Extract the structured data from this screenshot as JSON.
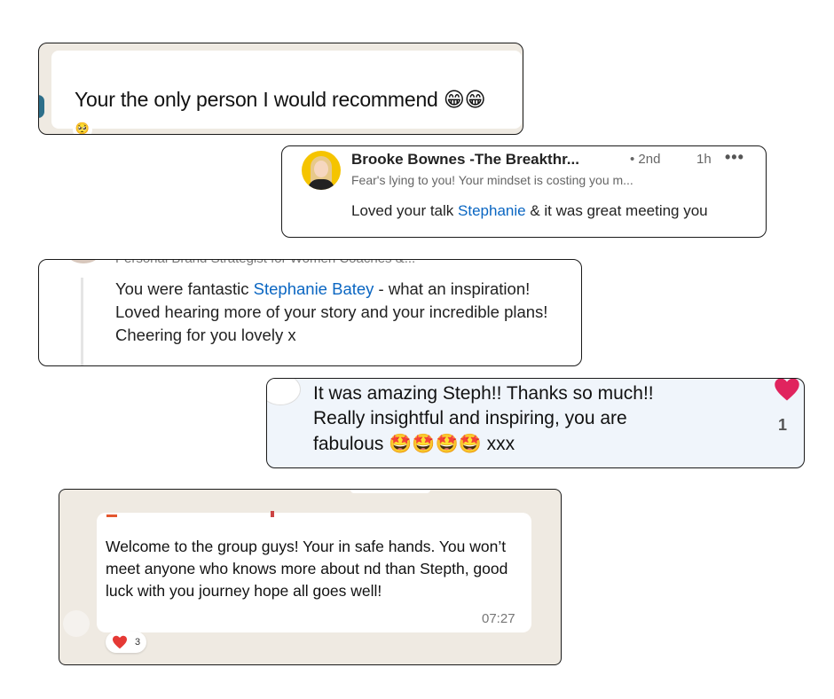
{
  "card1": {
    "message": "Your the only person I would recommend",
    "emojis": "😁😁",
    "reaction": "🥺"
  },
  "card2": {
    "name": "Brooke Bownes -The  Breakthr...",
    "degree": "• 2nd",
    "time": "1h",
    "more": "•••",
    "headline": "Fear's lying to you! Your mindset is costing you m...",
    "comment_prefix": "Loved your talk ",
    "mention": "Stephanie",
    "comment_suffix": " & it was great meeting you"
  },
  "card3": {
    "cut_headline": "Personal Brand Strategist for Women Coaches &...",
    "comment_prefix": "You were fantastic ",
    "mention": "Stephanie Batey",
    "comment_suffix": " - what an inspiration! Loved hearing more of your story and your incredible plans! Cheering for you lovely x"
  },
  "card4": {
    "comment_line1": "It was amazing Steph!! Thanks so much!!",
    "comment_line2": "Really insightful and inspiring, you are",
    "comment_line3_text": "fabulous ",
    "emojis": "🤩🤩🤩🤩",
    "comment_end": " xxx",
    "reaction_count": "1",
    "heart_color": "#e0245e"
  },
  "card5": {
    "message": "Welcome to the group guys! Your in safe hands. You won’t meet anyone who knows more about nd than Stepth, good luck with you journey hope all goes well!",
    "time": "07:27",
    "reaction_count": "3",
    "heart_color": "#e53935"
  }
}
